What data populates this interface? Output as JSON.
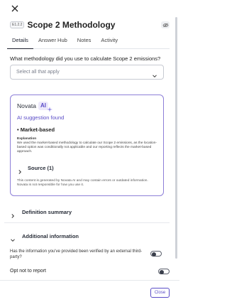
{
  "header": {
    "code": "E1.2.2",
    "title": "Scope 2 Methodology"
  },
  "tabs": [
    {
      "label": "Details",
      "active": true
    },
    {
      "label": "Answer Hub",
      "active": false
    },
    {
      "label": "Notes",
      "active": false
    },
    {
      "label": "Activity",
      "active": false
    }
  ],
  "question": {
    "text": "What methodology did you use to calculate Scope 2 emissions?",
    "select_placeholder": "Select all that apply"
  },
  "ai_card": {
    "brand": "Novata",
    "badge": "AI",
    "found_text": "AI suggestion found",
    "answer": "• Market-based",
    "explanation_label": "Explanation",
    "explanation_text": "We used the market-based methodology to calculate our Scope 2 emissions, as the location-based option was conditionally not applicable and our reporting reflects the market-based approach.",
    "source_label": "Source (1)",
    "disclaimer": "This content is generated by Novata AI and may contain errors or outdated information. Novata is not responsible for how you use it."
  },
  "sections": {
    "definition_summary": "Definition summary",
    "additional_information": "Additional information"
  },
  "verification": {
    "question": "Has the information you've provided been verified by an external third-party?",
    "toggle_on": false
  },
  "opt_out": {
    "label": "Opt not to report",
    "toggle_on": false
  },
  "footer": {
    "close_label": "Close"
  },
  "colors": {
    "accent": "#5a4cc7",
    "card_border": "#8d7fd8"
  }
}
